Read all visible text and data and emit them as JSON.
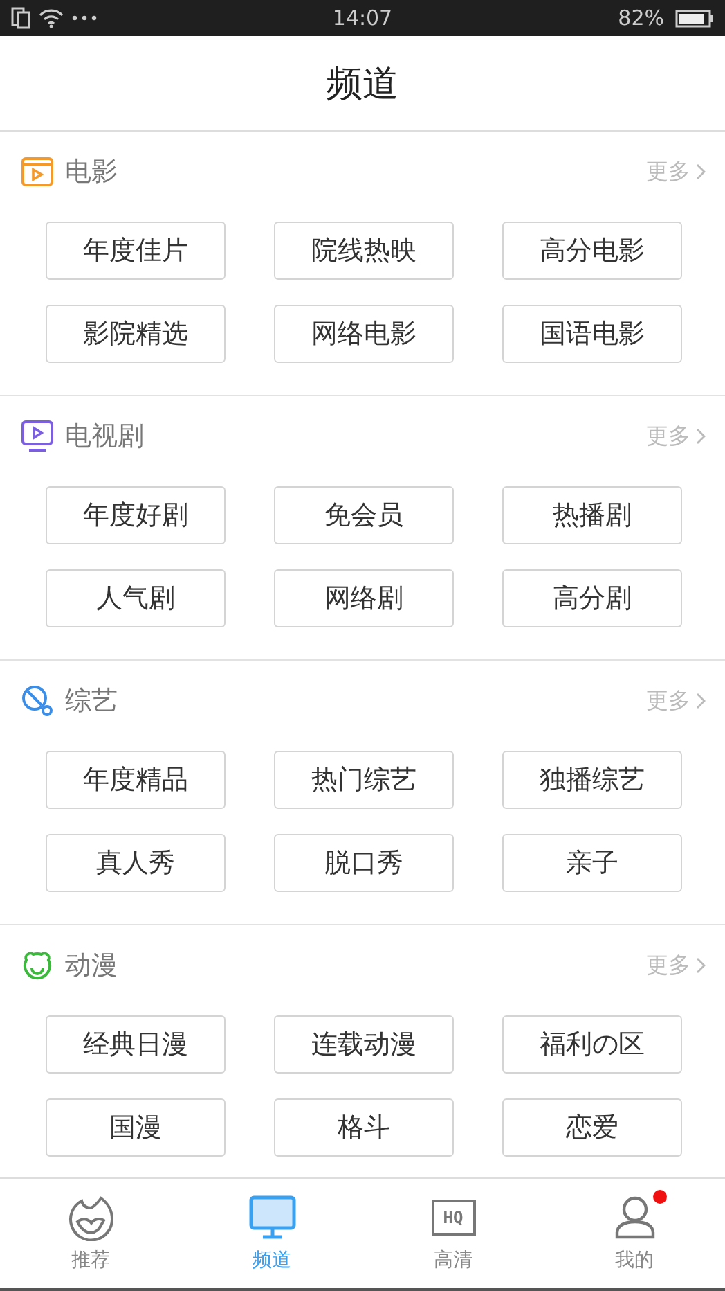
{
  "status_bar": {
    "time": "14:07",
    "battery": "82%"
  },
  "title": "频道",
  "sections": [
    {
      "kind": "movie",
      "title": "电影",
      "color": "#f39a2b",
      "more": "更多",
      "items": [
        "年度佳片",
        "院线热映",
        "高分电影",
        "影院精选",
        "网络电影",
        "国语电影"
      ]
    },
    {
      "kind": "tv",
      "title": "电视剧",
      "color": "#7b5fe0",
      "more": "更多",
      "items": [
        "年度好剧",
        "免会员",
        "热播剧",
        "人气剧",
        "网络剧",
        "高分剧"
      ]
    },
    {
      "kind": "variety",
      "title": "综艺",
      "color": "#3a8ee8",
      "more": "更多",
      "items": [
        "年度精品",
        "热门综艺",
        "独播综艺",
        "真人秀",
        "脱口秀",
        "亲子"
      ]
    },
    {
      "kind": "anime",
      "title": "动漫",
      "color": "#3cb83c",
      "more": "更多",
      "items": [
        "经典日漫",
        "连载动漫",
        "福利の区",
        "国漫",
        "格斗",
        "恋爱"
      ]
    }
  ],
  "tabs": [
    {
      "kind": "flame",
      "label": "推荐",
      "selected": false,
      "badge": false
    },
    {
      "kind": "monitor",
      "label": "频道",
      "selected": true,
      "badge": false
    },
    {
      "kind": "hq",
      "label": "高清",
      "selected": false,
      "badge": false,
      "icon_text": "HQ"
    },
    {
      "kind": "person",
      "label": "我的",
      "selected": false,
      "badge": true
    }
  ]
}
